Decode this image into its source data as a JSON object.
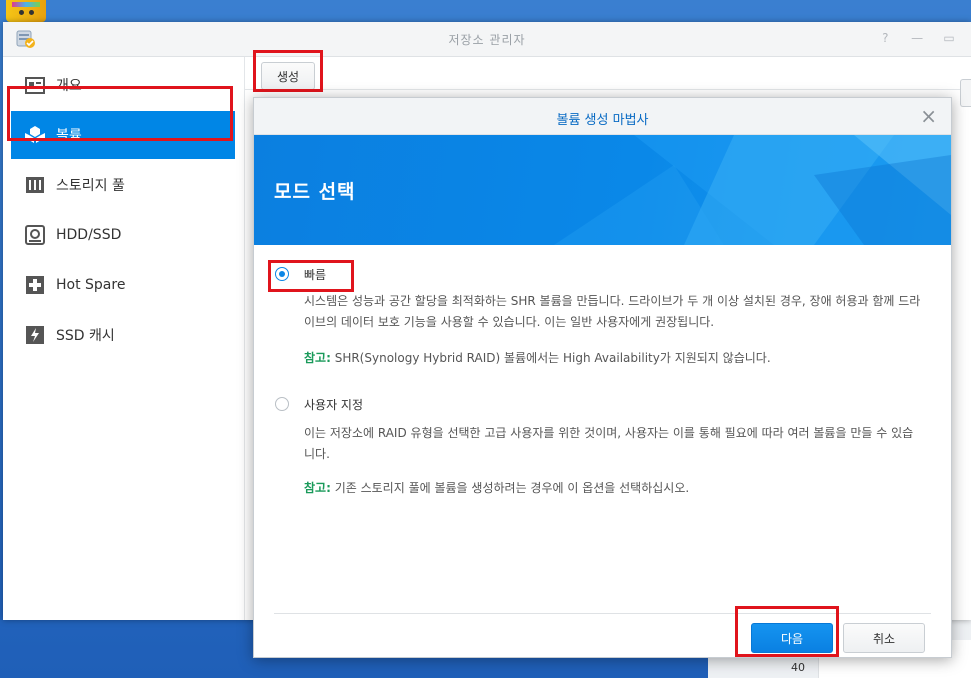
{
  "window": {
    "title": "저장소 관리자",
    "controls": [
      "?",
      "—",
      "▭"
    ]
  },
  "sidebar": {
    "items": [
      {
        "label": "개요",
        "icon": "overview-icon",
        "active": false
      },
      {
        "label": "볼륨",
        "icon": "volume-icon",
        "active": true
      },
      {
        "label": "스토리지 풀",
        "icon": "storage-pool-icon",
        "active": false
      },
      {
        "label": "HDD/SSD",
        "icon": "hdd-icon",
        "active": false
      },
      {
        "label": "Hot Spare",
        "icon": "hot-spare-icon",
        "active": false
      },
      {
        "label": "SSD 캐시",
        "icon": "ssd-cache-icon",
        "active": false
      }
    ]
  },
  "toolbar": {
    "create_label": "생성"
  },
  "background": {
    "number": "40"
  },
  "dialog": {
    "title": "볼륨 생성 마법사",
    "banner_heading": "모드 선택",
    "options": [
      {
        "label": "빠름",
        "selected": true,
        "description": "시스템은 성능과 공간 할당을 최적화하는 SHR 볼륨을 만듭니다. 드라이브가 두 개 이상 설치된 경우, 장애 허용과 함께 드라이브의 데이터 보호 기능을 사용할 수 있습니다. 이는 일반 사용자에게 권장됩니다.",
        "note_label": "참고:",
        "note_text": " SHR(Synology Hybrid RAID) 볼륨에서는 High Availability가 지원되지 않습니다."
      },
      {
        "label": "사용자 지정",
        "selected": false,
        "description": "이는 저장소에 RAID 유형을 선택한 고급 사용자를 위한 것이며, 사용자는 이를 통해 필요에 따라 여러 볼륨을 만들 수 있습니다.",
        "note_label": "참고:",
        "note_text": " 기존 스토리지 풀에 볼륨을 생성하려는 경우에 이 옵션을 선택하십시오."
      }
    ],
    "next_label": "다음",
    "cancel_label": "취소"
  },
  "colors": {
    "accent": "#0086e6",
    "highlight_box": "#e0141c",
    "note_label": "#1a9a5a"
  }
}
